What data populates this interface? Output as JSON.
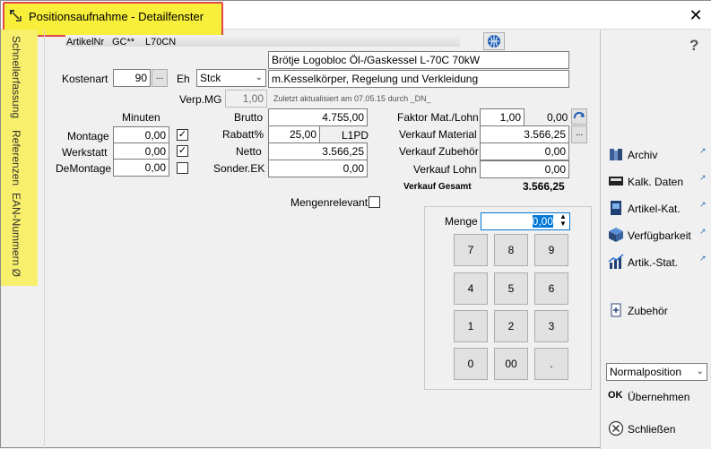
{
  "window": {
    "title": "Positionsaufnahme - Detailfenster",
    "close_glyph": "✕"
  },
  "sidebar": {
    "tabs": [
      {
        "label": "Schnellerfassung"
      },
      {
        "label": "Referenzen"
      },
      {
        "label": "EAN-Nummern Ø"
      }
    ]
  },
  "article": {
    "artikelnr_label": "ArtikelNr",
    "artikelnr_prefix": "GC**",
    "artikelnr_value": "L70CN",
    "description1": "Brötje Logobloc Öl-/Gaskessel L-70C 70kW",
    "description2": "m.Kesselkörper, Regelung und Verkleidung"
  },
  "cost": {
    "kostenart_label": "Kostenart",
    "kostenart_value": "90",
    "ellipsis": "...",
    "eh_label": "Eh",
    "eh_value": "Stck",
    "verpmg_label": "Verp.MG",
    "verpmg_value": "1,00",
    "updated_text": "Zuletzt aktualisiert am 07.05.15 durch _DN_"
  },
  "minutes": {
    "header": "Minuten",
    "rows": [
      {
        "label": "Montage",
        "value": "0,00",
        "checked": true
      },
      {
        "label": "Werkstatt",
        "value": "0,00",
        "checked": true
      },
      {
        "label": "DeMontage",
        "value": "0,00",
        "checked": false
      }
    ],
    "check_glyph": "✓"
  },
  "prices": {
    "brutto_label": "Brutto",
    "brutto_value": "4.755,00",
    "rabatt_label": "Rabatt%",
    "rabatt_value": "25,00",
    "rabatt_code": "L1PD",
    "netto_label": "Netto",
    "netto_value": "3.566,25",
    "sonder_label": "Sonder.EK",
    "sonder_value": "0,00"
  },
  "sales": {
    "faktor_label": "Faktor Mat./Lohn",
    "faktor_value": "1,00",
    "faktor_result": "0,00",
    "material_label": "Verkauf Material",
    "material_value": "3.566,25",
    "zubehoer_label": "Verkauf Zubehör",
    "zubehoer_value": "0,00",
    "lohn_label": "Verkauf Lohn",
    "lohn_value": "0,00",
    "gesamt_label": "Verkauf Gesamt",
    "gesamt_value": "3.566,25"
  },
  "mengenrelevant_label": "Mengenrelevant",
  "numpad": {
    "menge_label": "Menge",
    "menge_value": "0,00",
    "keys": [
      "7",
      "8",
      "9",
      "4",
      "5",
      "6",
      "1",
      "2",
      "3",
      "0",
      "00",
      "."
    ]
  },
  "right_panel": {
    "help_glyph": "?",
    "items": [
      {
        "label": "Archiv",
        "icon": "archive-icon"
      },
      {
        "label": "Kalk. Daten",
        "icon": "calc-data-icon"
      },
      {
        "label": "Artikel-Kat.",
        "icon": "catalog-icon"
      },
      {
        "label": "Verfügbarkeit",
        "icon": "availability-icon"
      },
      {
        "label": "Artik.-Stat.",
        "icon": "stats-chart-icon"
      }
    ],
    "zubehoer_label": "Zubehör",
    "position_select": "Normalposition",
    "ok_label": "Übernehmen",
    "close_label": "Schließen"
  },
  "colors": {
    "highlight_yellow": "#f8ef3a",
    "highlight_border": "#e0474c",
    "selection_blue": "#0078d7"
  }
}
